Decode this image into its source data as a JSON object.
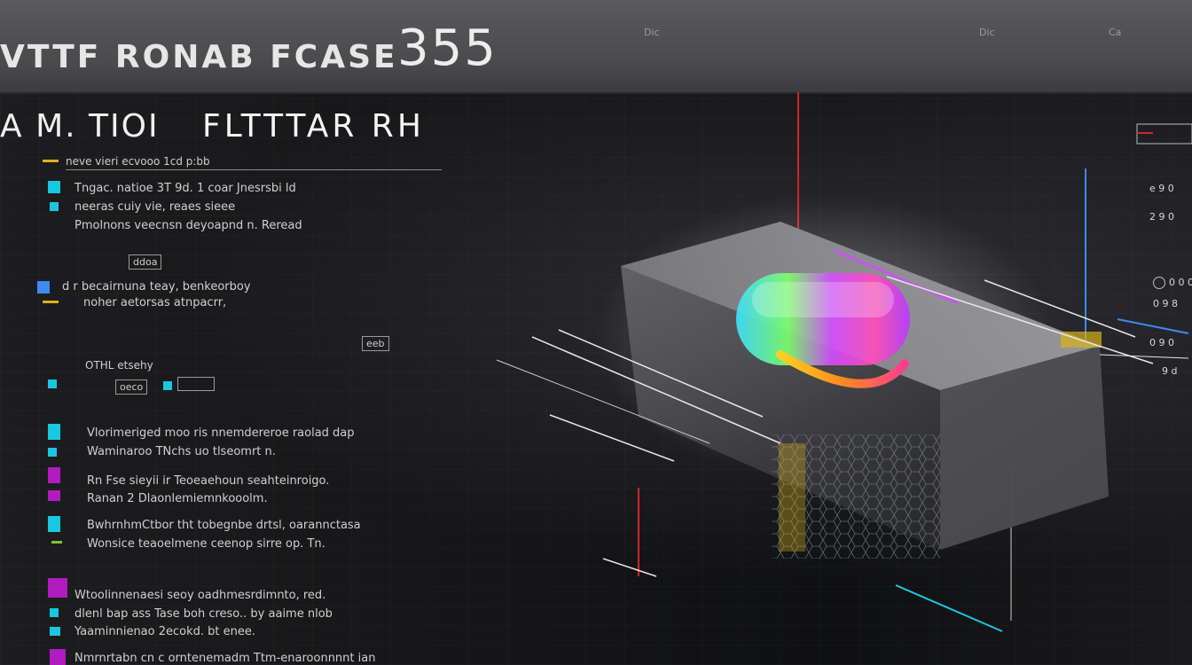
{
  "header": {
    "title": "VTTF RONAB FCASE",
    "number": "355",
    "small_labels": [
      "Dic",
      "Dic",
      "Ca"
    ]
  },
  "section": {
    "heading_left": "A M. TIOI",
    "heading_right": "FLTTTAR RH",
    "subheading": "neve vieri ecvooo 1cd p:bb"
  },
  "left_list": [
    {
      "text": "Tngac. natioe 3T 9d. 1 coar Jnesrsbi ld"
    },
    {
      "text": "neeras cuiy vie, reaes sieee"
    },
    {
      "text": "Pmolnons veecnsn deyoapnd n. Reread"
    },
    {
      "text": "ddoa"
    },
    {
      "text": "d r becairnuna teay, benkeorboy"
    },
    {
      "text": "noher aetorsas atnpacrr,"
    },
    {
      "text": "eeb"
    },
    {
      "text": "OTHL etsehy"
    },
    {
      "text": "oeco"
    },
    {
      "text": "Vlorimeriged moo ris nnemdereroe raolad dap"
    },
    {
      "text": "Waminaroo TNchs uo tlseomrt n."
    },
    {
      "text": "Rn Fse sieyii ir Teoeaehoun seahteinroigo."
    },
    {
      "text": "Ranan 2 Dlaonlemiemnkooolm."
    },
    {
      "text": "BwhrnhmCtbor tht tobegnbe drtsl, oarannctasa"
    },
    {
      "text": "Wonsice teaoelmene ceenop sirre op. Tn."
    },
    {
      "text": "Wtoolinnenaesi seoy oadhmesrdimnto, red."
    },
    {
      "text": "dlenl bap ass Tase boh creso.. by aaime nlob"
    },
    {
      "text": "Yaaminnienao 2ecokd. bt enee."
    },
    {
      "text": "Nmrnrtabn cn c orntenemadm Ttm-enaroonnnnt ian"
    }
  ],
  "right_labels": [
    "e 9 0",
    "2 9 0",
    "0 0 0",
    "0 9 8",
    "0 9 0",
    "9 d"
  ],
  "colors": {
    "cyan": "#19c8e0",
    "magenta": "#b01cc0",
    "yellow": "#d9b21a",
    "green": "#7ac830",
    "red": "#d0242b",
    "blue": "#3a8cf0"
  }
}
